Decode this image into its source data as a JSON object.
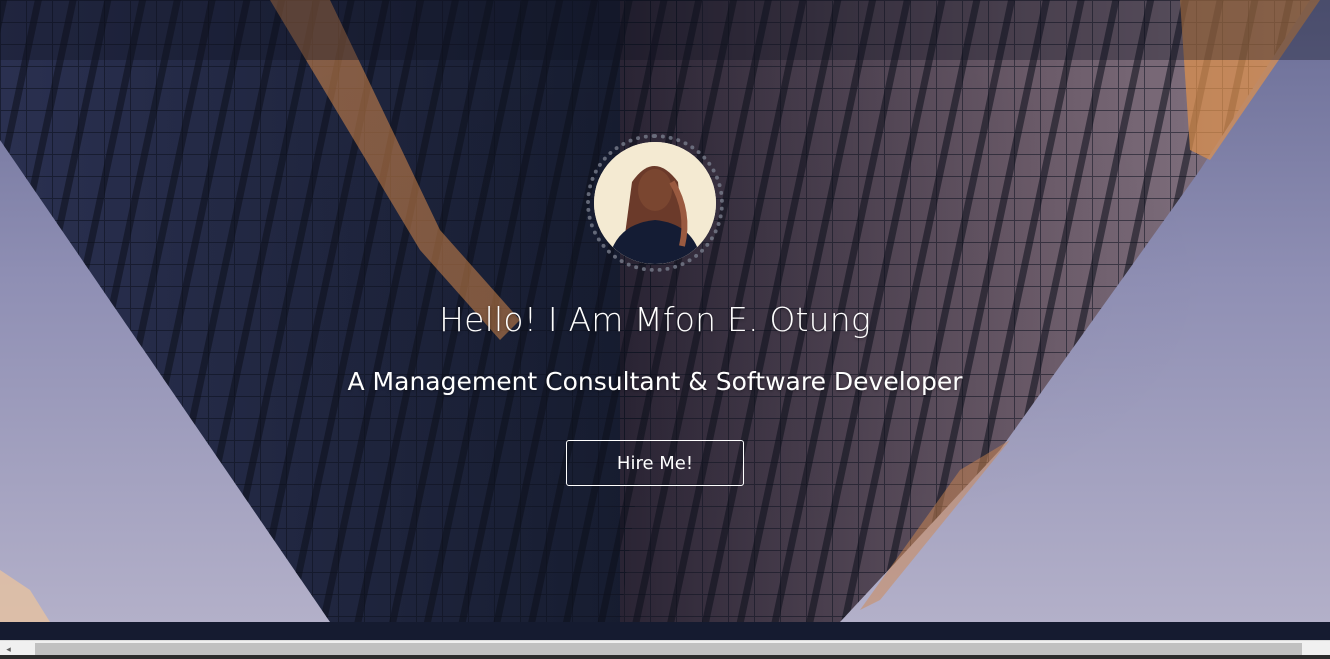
{
  "hero": {
    "title": "Hello! I Am Mfon E. Otung",
    "subtitle": "A Management Consultant & Software Developer",
    "cta_label": "Hire Me!"
  },
  "avatar": {
    "icon": "profile-photo"
  },
  "scrollbar": {
    "left_arrow": "◂"
  },
  "colors": {
    "text": "#ffffff",
    "band": "#151b30",
    "scroll_track": "#f0f0f0",
    "scroll_thumb": "#c1c1c1"
  }
}
